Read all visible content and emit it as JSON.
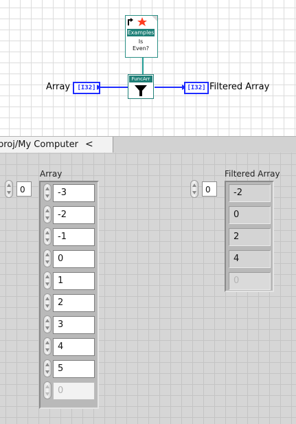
{
  "block_diagram": {
    "input_label": "Array",
    "input_terminal": "[I32]",
    "output_terminal": "[I32]",
    "output_label": "Filtered Array",
    "predicate_vi": {
      "header": "Examples",
      "line1": "Is",
      "line2": "Even?"
    },
    "function_node": {
      "header": "FuncArr",
      "icon": "filter-icon"
    },
    "colors": {
      "wire_int": "#1d2bff",
      "wire_ref": "#1f9a92"
    }
  },
  "path_tab": {
    "label": "proj/My Computer",
    "chevron": "<"
  },
  "front_panel": {
    "input_array": {
      "label": "Array",
      "index": "0",
      "values": [
        "-3",
        "-2",
        "-1",
        "0",
        "1",
        "2",
        "3",
        "4",
        "5"
      ],
      "empty_value": "0"
    },
    "output_array": {
      "label": "Filtered Array",
      "index": "0",
      "values": [
        "-2",
        "0",
        "2",
        "4"
      ],
      "empty_value": "0"
    }
  }
}
